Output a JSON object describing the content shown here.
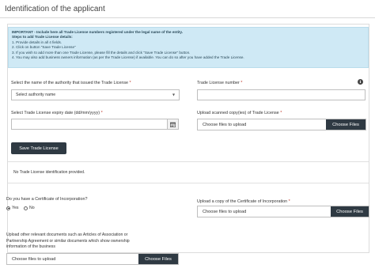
{
  "page": {
    "title": "Identification of the applicant"
  },
  "info": {
    "lines": [
      "IMPORTANT - Include here all Trade License numbers registered under the legal name of the entity.",
      "Steps to add Trade License details:",
      "1. Provide details in all 4 fields.",
      "2. Click on button \"Save Trade License\"",
      "3. If you wish to add more than one Trade License, please fill the details and click \"Save Trade License\" button.",
      "4. You may also add business owners information (as per the Trade License) if available. You can do so after you have added the Trade License."
    ]
  },
  "trade_license": {
    "authority_label": "Select the name of the authority that issued the Trade License",
    "authority_selected": "Select authority name",
    "number_label": "Trade License number",
    "expiry_label": "Select Trade License expiry date (dd/mm/yyyy)",
    "expiry_value": "",
    "upload_label": "Upload scanned copy(ies) of Trade License",
    "upload_placeholder": "Choose files to upload",
    "upload_button": "Choose Files",
    "save_button": "Save Trade License",
    "status_text": "No Trade License identification provided.",
    "required_mark": "*"
  },
  "incorporation": {
    "question": "Do you have a Certificate of Incorporation?",
    "yes_label": "Yes",
    "no_label": "No",
    "upload_label": "Upload a copy of the Certificate of Incorporation",
    "upload_placeholder": "Choose files to upload",
    "upload_button": "Choose Files",
    "required_mark": "*"
  },
  "other_docs": {
    "label_lines": [
      "Upload other relevant documents such as Articles of Association or",
      "Partnership Agreement or similar documents which show ownership",
      "information of the business"
    ],
    "upload_placeholder": "Choose files to upload",
    "upload_button": "Choose Files"
  },
  "icons": {
    "dropdown": "chevron-down-icon",
    "calendar": "calendar-icon",
    "info": "info-icon"
  },
  "colors": {
    "info_bg": "#cfe9f5",
    "button_bg": "#2f3a43",
    "required": "#c0392b"
  }
}
